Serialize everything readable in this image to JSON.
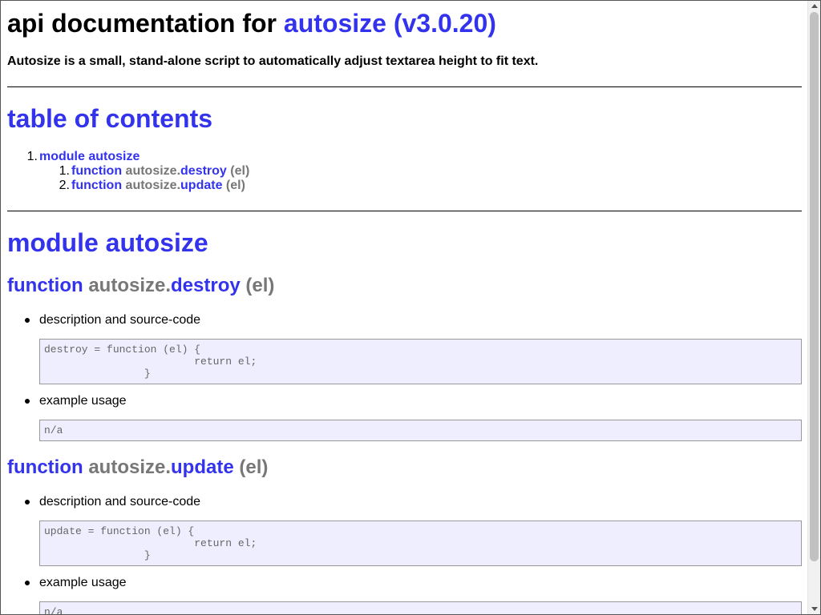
{
  "header": {
    "title_prefix": "api documentation for ",
    "title_link": "autosize (v3.0.20)",
    "description": "Autosize is a small, stand-alone script to automatically adjust textarea height to fit text."
  },
  "toc": {
    "title": "table of contents",
    "items": [
      {
        "number": "1.",
        "label": "module autosize",
        "children": [
          {
            "number": "1.",
            "keyword": "function",
            "object": "autosize.",
            "name": "destroy",
            "args": "(el)"
          },
          {
            "number": "2.",
            "keyword": "function",
            "object": "autosize.",
            "name": "update",
            "args": "(el)"
          }
        ]
      }
    ]
  },
  "module": {
    "title": "module autosize",
    "functions": [
      {
        "keyword": "function",
        "object": "autosize.",
        "name": "destroy",
        "args": "(el)",
        "source_label": "description and source-code",
        "source_code": "destroy = function (el) {\n                        return el;\n                }",
        "example_label": "example usage",
        "example_code": "n/a"
      },
      {
        "keyword": "function",
        "object": "autosize.",
        "name": "update",
        "args": "(el)",
        "source_label": "description and source-code",
        "source_code": "update = function (el) {\n                        return el;\n                }",
        "example_label": "example usage",
        "example_code": "n/a"
      }
    ]
  },
  "colors": {
    "link": "#3333ee",
    "muted": "#777777",
    "code_background": "#eeeeff"
  }
}
